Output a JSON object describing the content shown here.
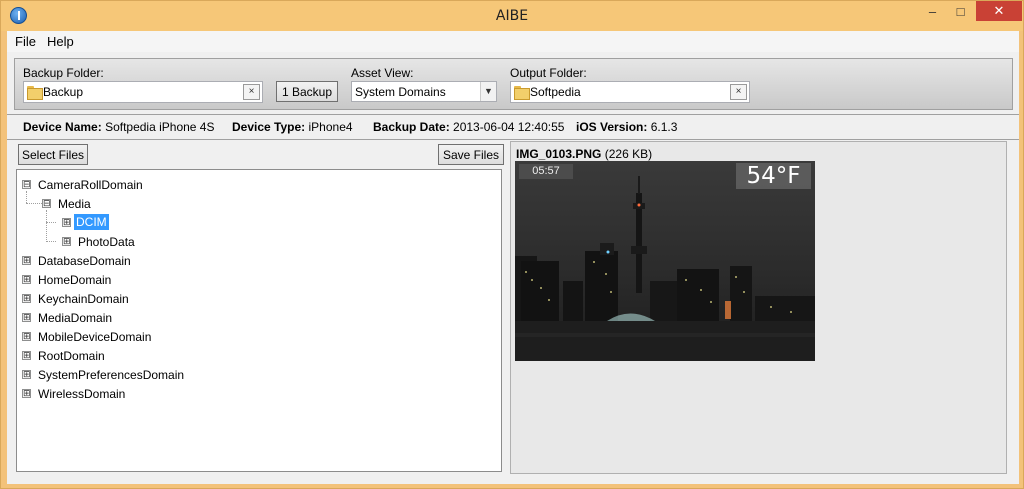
{
  "window": {
    "title": "AIBE",
    "minimize_glyph": "–",
    "maximize_glyph": "□",
    "close_glyph": "✕"
  },
  "menu": [
    "File",
    "Help"
  ],
  "toolbar": {
    "backup_folder_label": "Backup Folder:",
    "backup_folder_value": "Backup",
    "clear_glyph": "×",
    "backup_count_button": "1 Backup",
    "asset_view_label": "Asset View:",
    "asset_view_value": "System Domains",
    "output_folder_label": "Output Folder:",
    "output_folder_value": "Softpedia"
  },
  "device_info": {
    "device_name_label": "Device Name:",
    "device_name": "Softpedia iPhone 4S",
    "device_type_label": "Device Type:",
    "device_type": "iPhone4",
    "backup_date_label": "Backup Date:",
    "backup_date": "2013-06-04 12:40:55",
    "ios_version_label": "iOS Version:",
    "ios_version": "6.1.3"
  },
  "buttons": {
    "select_files": "Select Files",
    "save_files": "Save Files"
  },
  "tree": {
    "expand_glyph": "⊞",
    "collapse_glyph": "⊟",
    "camera_roll": "CameraRollDomain",
    "media": "Media",
    "dcim": "DCIM",
    "photo_data": "PhotoData",
    "domains": [
      "DatabaseDomain",
      "HomeDomain",
      "KeychainDomain",
      "MediaDomain",
      "MobileDeviceDomain",
      "RootDomain",
      "SystemPreferencesDomain",
      "WirelessDomain"
    ]
  },
  "preview": {
    "file_name": "IMG_0103.PNG",
    "file_size": "(226 KB)",
    "time": "05:57",
    "temperature": "54°F"
  },
  "colors": {
    "title_bar": "#f6c778",
    "close_button": "#c94135",
    "selection": "#3399ff"
  }
}
